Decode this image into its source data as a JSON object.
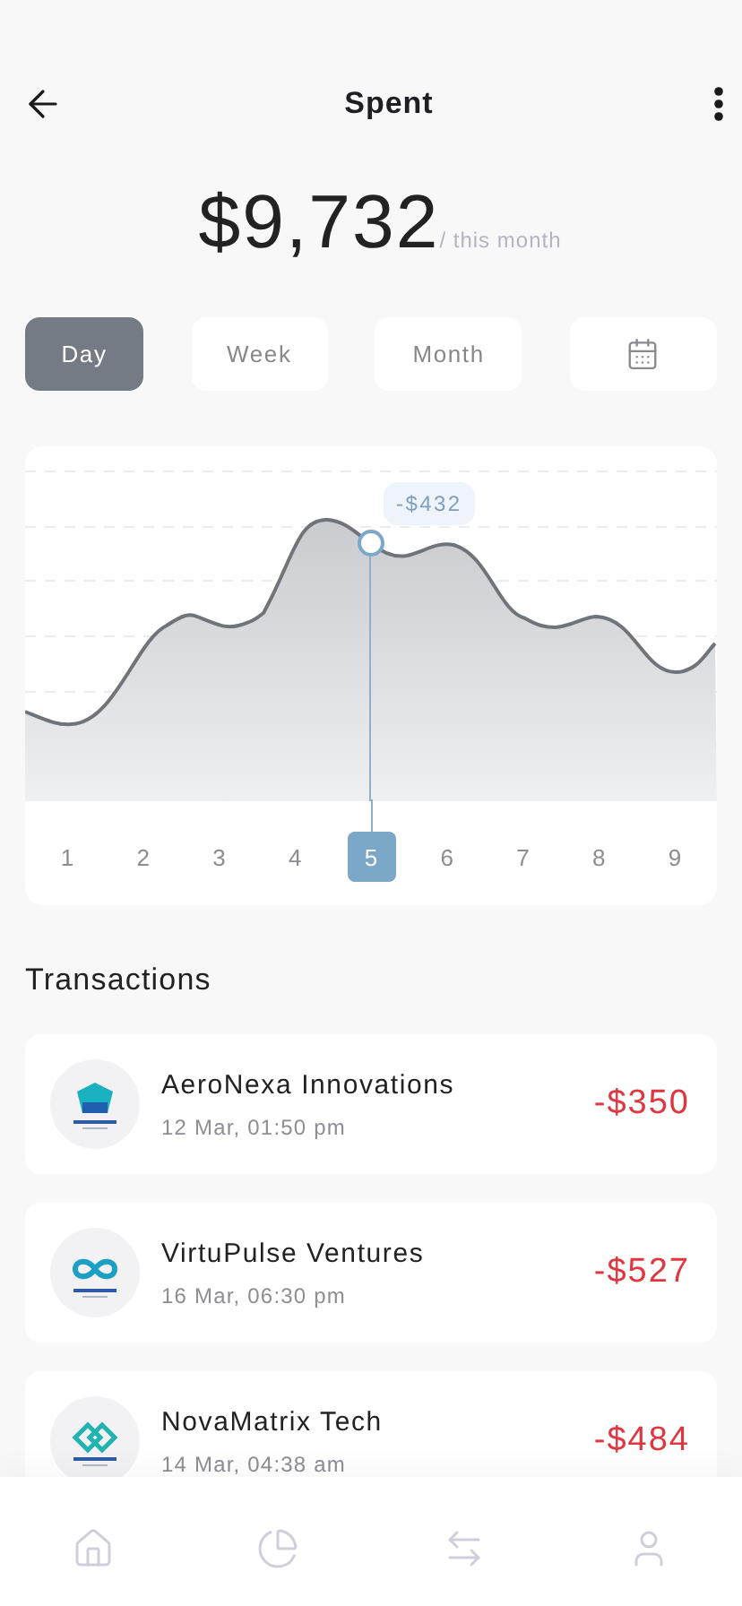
{
  "header": {
    "title": "Spent"
  },
  "summary": {
    "amount": "$9,732",
    "period": "/ this month"
  },
  "periods": [
    {
      "label": "Day",
      "selected": true
    },
    {
      "label": "Week",
      "selected": false
    },
    {
      "label": "Month",
      "selected": false
    }
  ],
  "chart": {
    "tooltip": "-$432",
    "days": [
      {
        "label": "1",
        "selected": false
      },
      {
        "label": "2",
        "selected": false
      },
      {
        "label": "3",
        "selected": false
      },
      {
        "label": "4",
        "selected": false
      },
      {
        "label": "5",
        "selected": true
      },
      {
        "label": "6",
        "selected": false
      },
      {
        "label": "7",
        "selected": false
      },
      {
        "label": "8",
        "selected": false
      },
      {
        "label": "9",
        "selected": false
      }
    ]
  },
  "transactions": {
    "title": "Transactions",
    "items": [
      {
        "kind": "pentagon",
        "name": "AeroNexa Innovations",
        "date": "12 Mar, 01:50 pm",
        "amount": "-$350"
      },
      {
        "kind": "infinity",
        "name": "VirtuPulse Ventures",
        "date": "16 Mar, 06:30 pm",
        "amount": "-$527"
      },
      {
        "kind": "diamonds",
        "name": "NovaMatrix Tech",
        "date": "14 Mar, 04:38 am",
        "amount": "-$484"
      }
    ]
  },
  "nav": [
    {
      "kind": "home"
    },
    {
      "kind": "chart"
    },
    {
      "kind": "transfer"
    },
    {
      "kind": "profile"
    }
  ]
}
